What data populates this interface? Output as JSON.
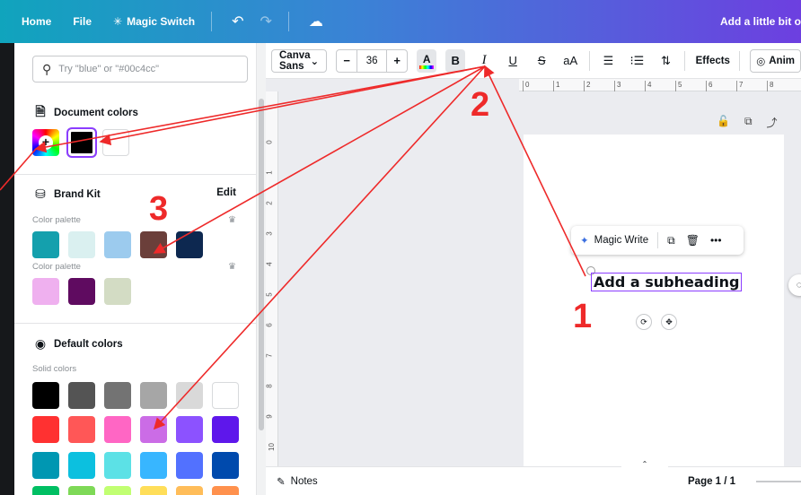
{
  "topbar": {
    "home": "Home",
    "file": "File",
    "magic_switch": "Magic Switch",
    "doc_title": "Add a little bit o"
  },
  "panel": {
    "search_placeholder": "Try \"blue\" or \"#00c4cc\"",
    "document_colors": {
      "title": "Document colors",
      "swatches": [
        "#000000",
        "#ffffff"
      ]
    },
    "brand_kit": {
      "title": "Brand Kit",
      "edit": "Edit",
      "palette_label_1": "Color palette",
      "palette_1": [
        "#14a0ad",
        "#daf0f0",
        "#9ccbee",
        "#6b3f3a",
        "#0d2850"
      ],
      "palette_label_2": "Color palette",
      "palette_2": [
        "#efb0ef",
        "#5f0b60",
        "#d3dcc4"
      ]
    },
    "default_colors": {
      "title": "Default colors",
      "solid_label": "Solid colors",
      "row_1": [
        "#000000",
        "#545454",
        "#737373",
        "#a6a6a6",
        "#d9d9d9",
        "#ffffff"
      ],
      "row_2": [
        "#ff3131",
        "#ff5757",
        "#ff66c4",
        "#cb6ce6",
        "#8c52ff",
        "#5e17eb"
      ],
      "row_3": [
        "#0097b2",
        "#0cc0df",
        "#5ce1e6",
        "#38b6ff",
        "#5271ff",
        "#004aad"
      ],
      "row_4": [
        "#00bf63",
        "#7ed957",
        "#c1ff72",
        "#ffde59",
        "#ffbd59",
        "#ff914d"
      ]
    }
  },
  "toolbar": {
    "font": "Canva Sans",
    "size_minus": "−",
    "size": "36",
    "size_plus": "+",
    "color_letter": "A",
    "bold": "B",
    "italic": "I",
    "underline": "U",
    "strike": "S",
    "case": "aA",
    "effects": "Effects",
    "animate": "Anim"
  },
  "ruler_ticks": [
    "0",
    "1",
    "2",
    "3",
    "4",
    "5",
    "6",
    "7",
    "8"
  ],
  "ruler_left_ticks": [
    "0",
    "1",
    "2",
    "3",
    "4",
    "5",
    "6",
    "7",
    "8",
    "9",
    "10"
  ],
  "canvas": {
    "magic_write": "Magic Write",
    "subheading": "Add a subheading"
  },
  "bottombar": {
    "notes": "Notes",
    "page": "Page 1 / 1"
  },
  "annotations": {
    "step_1": "1",
    "step_2": "2",
    "step_3": "3",
    "arrow_color": "#ee2a2a"
  }
}
